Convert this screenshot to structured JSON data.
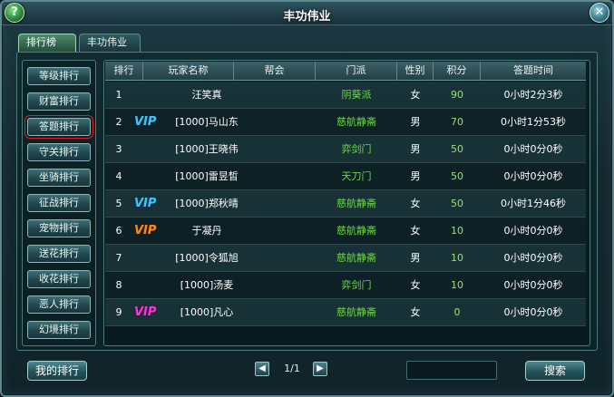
{
  "window": {
    "title": "丰功伟业",
    "help_glyph": "?",
    "close_glyph": "✕"
  },
  "tabs": [
    {
      "label": "排行榜",
      "active": true
    },
    {
      "label": "丰功伟业",
      "active": false
    }
  ],
  "sidebar": {
    "items": [
      {
        "label": "等级排行"
      },
      {
        "label": "财富排行"
      },
      {
        "label": "答题排行",
        "selected": true
      },
      {
        "label": "守关排行"
      },
      {
        "label": "坐骑排行"
      },
      {
        "label": "征战排行"
      },
      {
        "label": "宠物排行"
      },
      {
        "label": "送花排行"
      },
      {
        "label": "收花排行"
      },
      {
        "label": "恶人排行"
      },
      {
        "label": "幻境排行"
      }
    ]
  },
  "table": {
    "headers": [
      "排行",
      "玩家名称",
      "帮会",
      "门派",
      "性别",
      "积分",
      "答题时间"
    ],
    "rows": [
      {
        "rank": "1",
        "vip": "",
        "vip_color": "",
        "name": "汪笑真",
        "guild": "",
        "sect": "阴葵派",
        "gender": "女",
        "score": "90",
        "time": "0小时2分3秒"
      },
      {
        "rank": "2",
        "vip": "VIP",
        "vip_color": "blue",
        "name": "[1000]马山东",
        "guild": "",
        "sect": "慈航静斋",
        "gender": "男",
        "score": "70",
        "time": "0小时1分53秒"
      },
      {
        "rank": "3",
        "vip": "",
        "vip_color": "",
        "name": "[1000]王晓伟",
        "guild": "",
        "sect": "弈剑门",
        "gender": "男",
        "score": "50",
        "time": "0小时0分0秒"
      },
      {
        "rank": "4",
        "vip": "",
        "vip_color": "",
        "name": "[1000]雷昱皙",
        "guild": "",
        "sect": "天刀门",
        "gender": "男",
        "score": "50",
        "time": "0小时0分0秒"
      },
      {
        "rank": "5",
        "vip": "VIP",
        "vip_color": "blue",
        "name": "[1000]郑秋晴",
        "guild": "",
        "sect": "慈航静斋",
        "gender": "女",
        "score": "50",
        "time": "0小时1分46秒"
      },
      {
        "rank": "6",
        "vip": "VIP",
        "vip_color": "orange",
        "name": "于凝丹",
        "guild": "",
        "sect": "慈航静斋",
        "gender": "女",
        "score": "10",
        "time": "0小时0分0秒"
      },
      {
        "rank": "7",
        "vip": "",
        "vip_color": "",
        "name": "[1000]令狐旭",
        "guild": "",
        "sect": "慈航静斋",
        "gender": "男",
        "score": "10",
        "time": "0小时0分0秒"
      },
      {
        "rank": "8",
        "vip": "",
        "vip_color": "",
        "name": "[1000]汤麦",
        "guild": "",
        "sect": "弈剑门",
        "gender": "女",
        "score": "10",
        "time": "0小时0分0秒"
      },
      {
        "rank": "9",
        "vip": "VIP",
        "vip_color": "magenta",
        "name": "[1000]凡心",
        "guild": "",
        "sect": "慈航静斋",
        "gender": "女",
        "score": "0",
        "time": "0小时0分0秒"
      }
    ]
  },
  "footer": {
    "my_rank_label": "我的排行",
    "page_label": "1/1",
    "prev_glyph": "◀",
    "next_glyph": "▶",
    "search_value": "",
    "search_label": "搜索"
  }
}
